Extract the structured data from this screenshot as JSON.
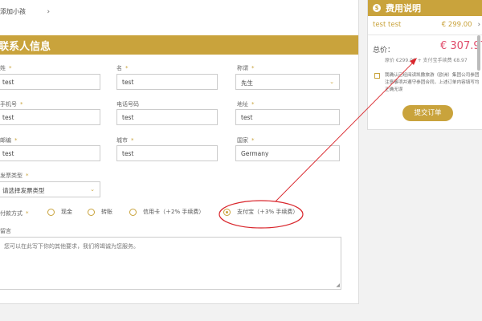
{
  "form": {
    "add_child": "添加小孩",
    "section_title": "联系人信息",
    "fields": {
      "last_name_label": "姓",
      "last_name_value": "test",
      "first_name_label": "名",
      "first_name_value": "test",
      "title_label": "称谓",
      "title_value": "先生",
      "mobile_label": "手机号",
      "mobile_value": "test",
      "phone_label": "电话号码",
      "phone_value": "test",
      "address_label": "地址",
      "address_value": "test",
      "postcode_label": "邮编",
      "postcode_value": "test",
      "city_label": "城市",
      "city_value": "test",
      "country_label": "国家",
      "country_value": "Germany",
      "invoice_type_label": "发票类型",
      "invoice_type_value": "请选择发票类型"
    },
    "payment": {
      "label": "付款方式",
      "options": [
        "现金",
        "转账",
        "信用卡（＋2% 手续费）",
        "支付宝（＋3% 手续费）"
      ],
      "selected": "支付宝（＋3% 手续费）"
    },
    "message": {
      "label": "留言",
      "placeholder": "您可以在此写下你的其他要求，我们将竭诚为您服务。"
    }
  },
  "summary": {
    "title": "费用说明",
    "item_name": "test test",
    "item_price": "€ 299.00",
    "total_label": "总价：",
    "total_value": "€ 307.97",
    "price_note": "原价 €299.00 + 支付宝手续费 €8.97",
    "terms": "我确认已经阅读凯撒旅游（欧洲）集团公司参团注意事项并遵守参团合同，上述订单内容填写均正确无误",
    "submit": "提交订单"
  },
  "colors": {
    "accent": "#c9a33c",
    "total_price": "#e04a6a",
    "annotation": "#d9262c"
  }
}
